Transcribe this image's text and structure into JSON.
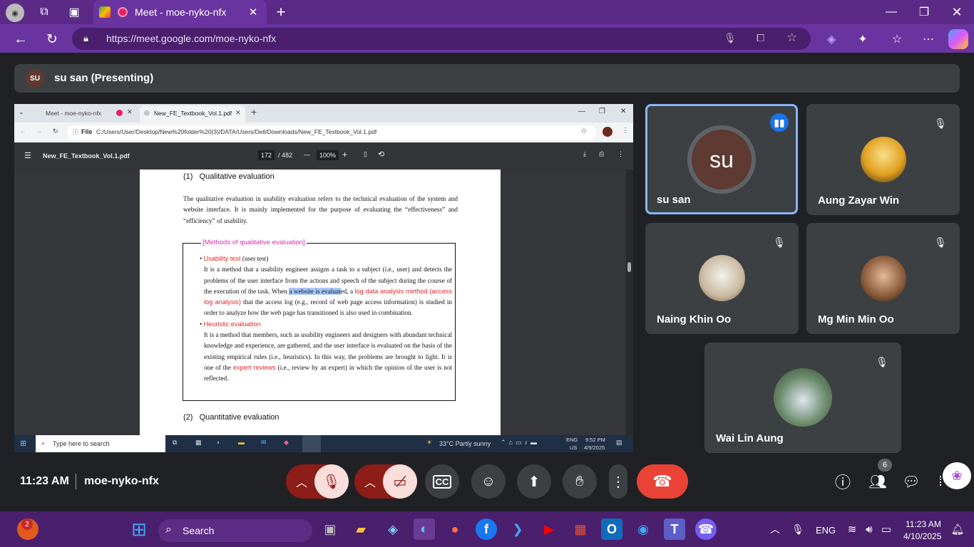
{
  "browser": {
    "tab_title": "Meet - moe-nyko-nfx",
    "url": "https://meet.google.com/moe-nyko-nfx"
  },
  "meet": {
    "presenter_initials": "SU",
    "presenter_label": "su san (Presenting)",
    "time": "11:23 AM",
    "meeting_code": "moe-nyko-nfx",
    "participant_count": "6"
  },
  "participants": [
    {
      "name": "su san",
      "initials": "su",
      "speaking": true
    },
    {
      "name": "Aung Zayar Win",
      "muted": true
    },
    {
      "name": "Naing Khin Oo",
      "muted": true
    },
    {
      "name": "Mg Min Min Oo",
      "muted": true
    },
    {
      "name": "Wai Lin Aung",
      "muted": true
    }
  ],
  "shared": {
    "tab1": "Meet - moe-nyko-nfx",
    "tab2": "New_FE_Textbook_Vol.1.pdf",
    "file_chip": "File",
    "path": "C:/Users/User/Desktop/New%20folder%20(3)/DATA/Users/Dell/Downloads/New_FE_Textbook_Vol.1.pdf",
    "pdf_title": "New_FE_Textbook_Vol.1.pdf",
    "page_current": "172",
    "page_total": "/ 482",
    "zoom": "100%",
    "heading1": "(1)   Qualitative evaluation",
    "para1": "The qualitative evaluation in usability evaluation refers to the technical evaluation of the system and website interface. It is mainly implemented for the purpose of evaluating the “effectiveness” and “efficiency” of usability.",
    "box_title": "[Methods of qualitative evaluation]",
    "item1_title": "Usability test",
    "item1_suffix": " (user test)",
    "item1_text_a": "It is a method that a usability engineer assigns a task to a subject (i.e., user) and detects the problems of the user interface from the actions and speech of the subject during the course of the execution of the task. When ",
    "item1_highlight": "a website is evaluat",
    "item1_text_b": "ed, a ",
    "item1_red": "log data analysis method (access log analysis)",
    "item1_text_c": " that the access log (e.g., record of web page access information) is studied in order to analyze how the web page has transitioned is also used in combination.",
    "item2_title": "Heuristic evaluation",
    "item2_text_a": "It is a method that members, such as usability engineers and designers with abundant technical knowledge and experience, are gathered, and the user interface is evaluated on the basis of the existing empirical rules (i.e., heuristics). In this way, the problems are brought to light. It is one of the ",
    "item2_red": "expert reviews",
    "item2_text_b": " (i.e., review by an expert) in which the opinion of the user is not reflected.",
    "heading2": "(2)   Quantitative evaluation",
    "win_search": "Type here to search",
    "weather": "33°C  Partly sunny",
    "lang1": "ENG",
    "lang2": "US",
    "clock_time": "9:52 PM",
    "clock_date": "4/9/2025"
  },
  "taskbar": {
    "search": "Search",
    "badge": "2",
    "lang": "ENG",
    "time": "11:23 AM",
    "date": "4/10/2025"
  },
  "colors": {
    "chrome_purple": "#6a34a0",
    "end_call": "#ea4335",
    "muted_control": "#8c1d18",
    "active_border": "#8ab4f8"
  }
}
